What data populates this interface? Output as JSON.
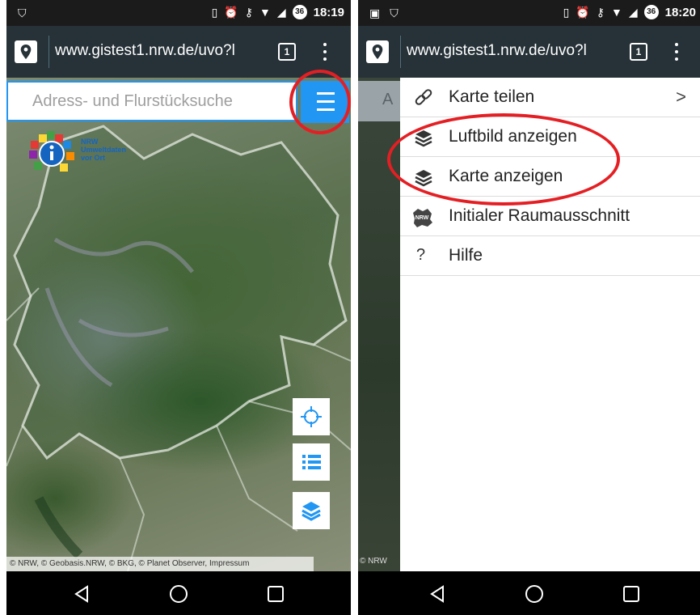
{
  "left_screen": {
    "status": {
      "time": "18:19",
      "battery": "36"
    },
    "browser": {
      "url": "www.gistest1.nrw.de/uvo?l",
      "tab_count": "1"
    },
    "search": {
      "placeholder": "Adress- und Flurstücksuche"
    },
    "logo": {
      "line1": "NRW",
      "line2": "Umweltdaten",
      "line3": "vor Ort"
    },
    "attribution": "© NRW, © Geobasis.NRW, © BKG, © Planet Observer, Impressum",
    "map_buttons": [
      {
        "icon": "crosshair-icon"
      },
      {
        "icon": "list-icon"
      },
      {
        "icon": "layers-icon"
      }
    ]
  },
  "right_screen": {
    "status": {
      "time": "18:20",
      "battery": "36"
    },
    "browser": {
      "url": "www.gistest1.nrw.de/uvo?l",
      "tab_count": "1"
    },
    "search_fragment": "A",
    "attribution_fragment": "© NRW",
    "menu": [
      {
        "label": "Karte teilen",
        "icon": "link-icon",
        "chevron": ">"
      },
      {
        "label": "Luftbild anzeigen",
        "icon": "layers-icon"
      },
      {
        "label": "Karte anzeigen",
        "icon": "layers-icon"
      },
      {
        "label": "Initialer Raumausschnitt",
        "icon": "nrw-shape-icon",
        "icon_text": "NRW"
      },
      {
        "label": "Hilfe",
        "icon": "help-icon",
        "icon_text": "?"
      }
    ]
  },
  "colors": {
    "accent": "#2196f3",
    "highlight_circle": "#e41f24",
    "url_bar": "#263238",
    "status_bar": "#1b1b1b"
  }
}
